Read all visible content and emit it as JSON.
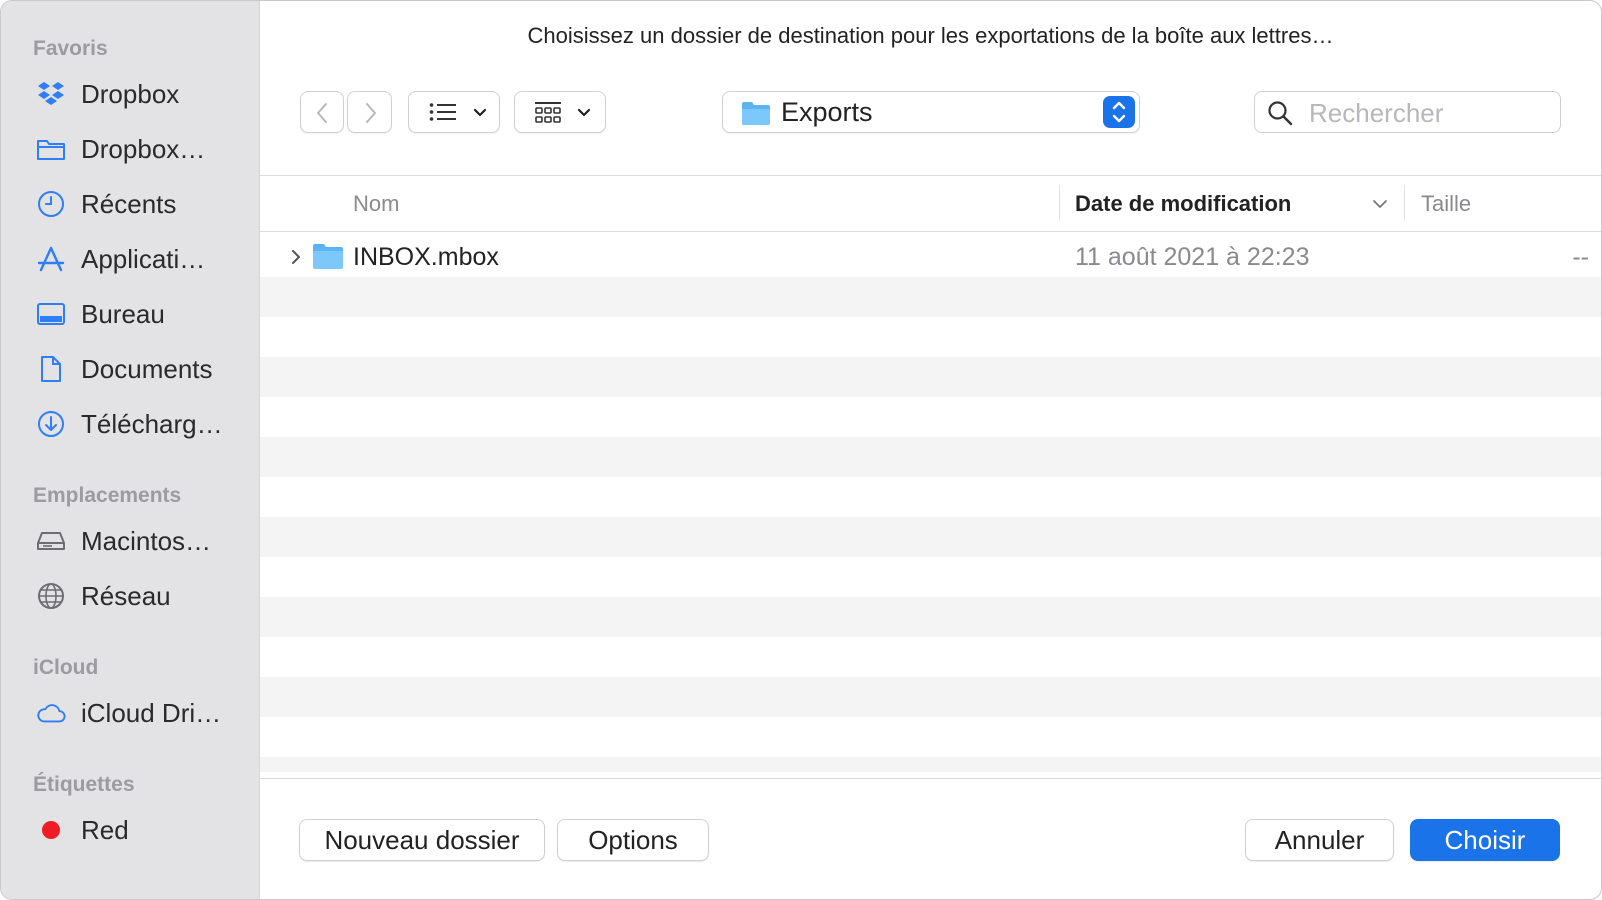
{
  "window": {
    "title": "Choisissez un dossier de destination pour les exportations de la boîte aux lettres…"
  },
  "sidebar": {
    "sections": [
      {
        "heading": "Favoris",
        "items": [
          {
            "label": "Dropbox",
            "icon": "dropbox-icon"
          },
          {
            "label": "Dropbox…",
            "icon": "folder-icon"
          },
          {
            "label": "Récents",
            "icon": "clock-icon"
          },
          {
            "label": "Applicati…",
            "icon": "applications-icon"
          },
          {
            "label": "Bureau",
            "icon": "desktop-icon"
          },
          {
            "label": "Documents",
            "icon": "document-icon"
          },
          {
            "label": "Télécharg…",
            "icon": "download-icon"
          }
        ]
      },
      {
        "heading": "Emplacements",
        "items": [
          {
            "label": "Macintos…",
            "icon": "hard-drive-icon"
          },
          {
            "label": "Réseau",
            "icon": "globe-icon"
          }
        ]
      },
      {
        "heading": "iCloud",
        "items": [
          {
            "label": "iCloud Dri…",
            "icon": "cloud-icon"
          }
        ]
      },
      {
        "heading": "Étiquettes",
        "items": [
          {
            "label": "Red",
            "icon": "tag-dot-icon",
            "color": "#ee1c24"
          }
        ]
      }
    ]
  },
  "toolbar": {
    "location": "Exports",
    "search_placeholder": "Rechercher"
  },
  "columns": {
    "name": "Nom",
    "date": "Date de modification",
    "size": "Taille"
  },
  "files": [
    {
      "name": "INBOX.mbox",
      "date": "11 août 2021 à 22:23",
      "size": "--"
    }
  ],
  "footer": {
    "new_folder": "Nouveau dossier",
    "options": "Options",
    "cancel": "Annuler",
    "choose": "Choisir"
  },
  "colors": {
    "accent": "#1a73e8",
    "sidebar_bg": "#e3e3e6",
    "stripe": "#f4f4f5",
    "icon_blue": "#2f7ef5"
  }
}
